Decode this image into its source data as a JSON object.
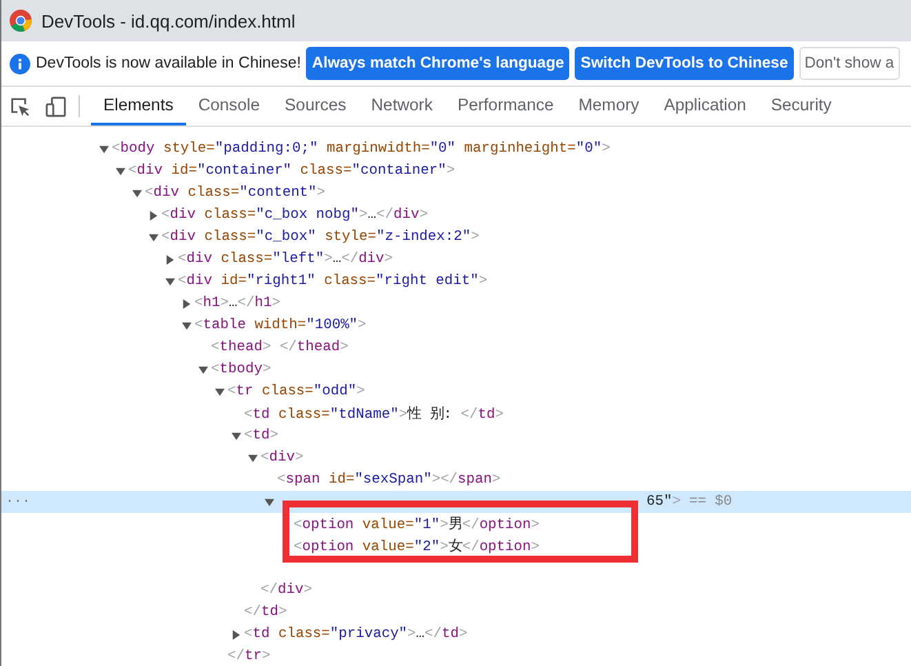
{
  "window": {
    "title": "DevTools - id.qq.com/index.html"
  },
  "infobar": {
    "message": "DevTools is now available in Chinese!",
    "buttons": [
      {
        "label": "Always match Chrome's language",
        "kind": "primary"
      },
      {
        "label": "Switch DevTools to Chinese",
        "kind": "primary"
      },
      {
        "label": "Don't show a",
        "kind": "plain"
      }
    ]
  },
  "tabs": [
    {
      "label": "Elements",
      "selected": true
    },
    {
      "label": "Console",
      "selected": false
    },
    {
      "label": "Sources",
      "selected": false
    },
    {
      "label": "Network",
      "selected": false
    },
    {
      "label": "Performance",
      "selected": false
    },
    {
      "label": "Memory",
      "selected": false
    },
    {
      "label": "Application",
      "selected": false
    },
    {
      "label": "Security",
      "selected": false
    }
  ],
  "dom_tree": {
    "selected_marker": "== $0",
    "gutter_mark": "···",
    "nodes": [
      {
        "text": "<body style=\"padding:0;\" marginwidth=\"0\" marginheight=\"0\">",
        "expanded": true,
        "selected": false,
        "children": [
          {
            "text": "<div id=\"container\" class=\"container\">",
            "expanded": true,
            "selected": false,
            "children": [
              {
                "text": "<div class=\"content\">",
                "expanded": true,
                "selected": false,
                "children": [
                  {
                    "text": "<div class=\"c_box nobg\">…</div>",
                    "expanded": false,
                    "selected": false
                  },
                  {
                    "text": "<div class=\"c_box\" style=\"z-index:2\">",
                    "expanded": true,
                    "selected": false,
                    "children": [
                      {
                        "text": "<div class=\"left\">…</div>",
                        "expanded": false,
                        "selected": false
                      },
                      {
                        "text": "<div id=\"right1\" class=\"right edit\">",
                        "expanded": true,
                        "selected": false,
                        "children": [
                          {
                            "text": "<h1>…</h1>",
                            "expanded": false,
                            "selected": false
                          },
                          {
                            "text": "<table width=\"100%\">",
                            "expanded": true,
                            "selected": false,
                            "children": [
                              {
                                "text": "<thead> </thead>",
                                "selected": false
                              },
                              {
                                "text": "<tbody>",
                                "expanded": true,
                                "selected": false,
                                "children": [
                                  {
                                    "text": "<tr class=\"odd\">",
                                    "expanded": true,
                                    "selected": false,
                                    "close": "</tr>",
                                    "children": [
                                      {
                                        "text": "<td class=\"tdName\">性 别: </td>",
                                        "selected": false
                                      },
                                      {
                                        "text": "<td>",
                                        "expanded": true,
                                        "selected": false,
                                        "close": "</td>",
                                        "children": [
                                          {
                                            "text": "<div>",
                                            "expanded": true,
                                            "selected": false,
                                            "close": "</div>",
                                            "children": [
                                              {
                                                "text": "<span id=\"sexSpan\"></span>",
                                                "selected": false
                                              },
                                              {
                                                "text": "65\">",
                                                "kind": "obscured",
                                                "expanded": true,
                                                "selected": true,
                                                "children": [
                                                  {
                                                    "text": "<option value=\"1\">男</option>",
                                                    "selected": false
                                                  },
                                                  {
                                                    "text": "<option value=\"2\">女</option>",
                                                    "selected": false
                                                  }
                                                ]
                                              }
                                            ]
                                          }
                                        ]
                                      },
                                      {
                                        "text": "<td class=\"privacy\">…</td>",
                                        "expanded": false,
                                        "selected": false
                                      }
                                    ]
                                  }
                                ]
                              }
                            ]
                          }
                        ]
                      }
                    ]
                  }
                ]
              }
            ]
          }
        ]
      }
    ]
  }
}
